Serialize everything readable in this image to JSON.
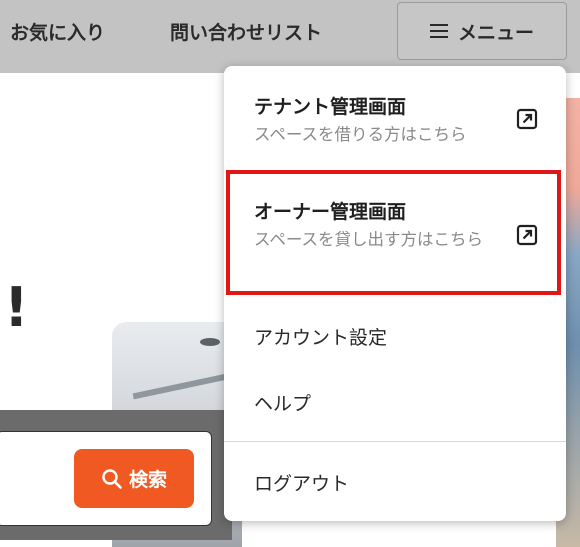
{
  "header": {
    "favorites_label": "お気に入り",
    "inquiry_list_label": "問い合わせリスト",
    "menu_label": "メニュー"
  },
  "page": {
    "exclamation": "!",
    "search_button_label": "検索"
  },
  "menu": {
    "tenant": {
      "title": "テナント管理画面",
      "subtitle": "スペースを借りる方はこちら"
    },
    "owner": {
      "title": "オーナー管理画面",
      "subtitle": "スペースを貸し出す方はこちら"
    },
    "account_settings_label": "アカウント設定",
    "help_label": "ヘルプ",
    "logout_label": "ログアウト"
  },
  "colors": {
    "header_bg": "#c3c3c3",
    "accent_orange": "#f05a22",
    "highlight_red": "#e01717"
  }
}
